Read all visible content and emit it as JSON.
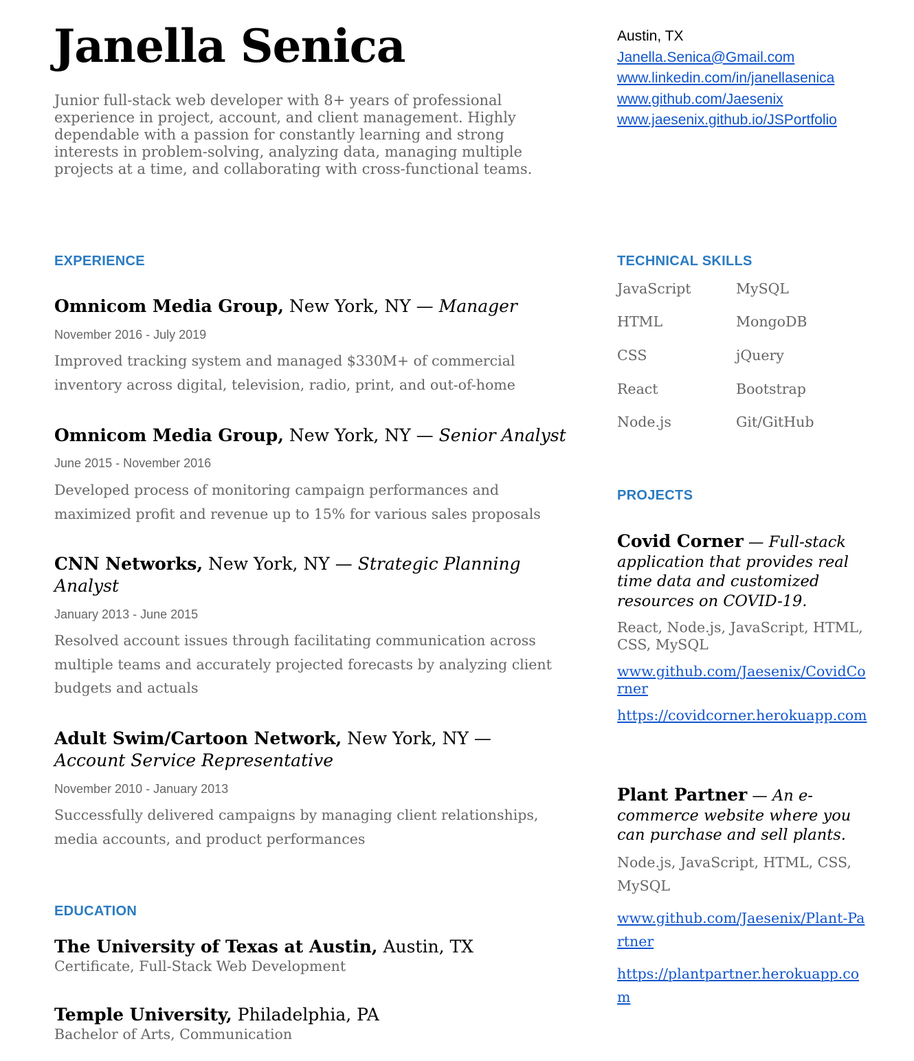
{
  "header": {
    "name": "Janella Senica",
    "summary": "Junior full-stack web developer with 8+ years of professional experience in project, account, and client management. Highly dependable with a passion for constantly learning and strong interests in problem-solving, analyzing data, managing multiple projects at a time, and collaborating with cross-functional teams."
  },
  "contact": {
    "location": "Austin, TX",
    "email": "Janella.Senica@Gmail.com",
    "linkedin": "www.linkedin.com/in/janellasenica",
    "github": "www.github.com/Jaesenix",
    "portfolio": "www.jaesenix.github.io/JSPortfolio"
  },
  "experience": {
    "heading": "EXPERIENCE",
    "jobs": [
      {
        "company": "Omnicom Media Group,",
        "location": " New York, NY — ",
        "role": "Manager",
        "dates": "November 2016  - July 2019",
        "description": "Improved tracking system and managed $330M+ of commercial inventory across digital, television, radio, print, and out-of-home"
      },
      {
        "company": "Omnicom Media Group,",
        "location": " New York, NY — ",
        "role": "Senior Analyst",
        "dates": "June 2015 - November 2016",
        "description": "Developed process of monitoring campaign performances and maximized profit and revenue up to 15% for various sales proposals"
      },
      {
        "company": "CNN Networks,",
        "location": " New York, NY — ",
        "role": "Strategic Planning Analyst",
        "dates": "January 2013 - June 2015",
        "description": "Resolved account issues through facilitating communication across multiple teams and accurately projected forecasts by analyzing client budgets and actuals"
      },
      {
        "company": "Adult Swim/Cartoon Network,",
        "location": " New York, NY — ",
        "role": "Account Service Representative",
        "dates": "November 2010 - January 2013",
        "description": "Successfully delivered campaigns by managing client relationships, media accounts, and product performances"
      }
    ]
  },
  "education": {
    "heading": "EDUCATION",
    "schools": [
      {
        "school": "The University of Texas at Austin,",
        "location": " Austin, TX",
        "degree": "Certificate, Full-Stack Web Development"
      },
      {
        "school": "Temple University,",
        "location": " Philadelphia, PA",
        "degree": "Bachelor of Arts, Communication"
      }
    ]
  },
  "skills": {
    "heading": "TECHNICAL SKILLS",
    "col1": [
      "JavaScript",
      "HTML",
      "CSS",
      "React",
      "Node.js"
    ],
    "col2": [
      "MySQL",
      "MongoDB",
      "jQuery",
      "Bootstrap",
      "Git/GitHub"
    ]
  },
  "projects": {
    "heading": "PROJECTS",
    "items": [
      {
        "name": "Covid Corner",
        "dash": " — ",
        "description": "Full-stack application that provides real time data and customized resources on COVID-19.",
        "tech": "React, Node.js, JavaScript, HTML, CSS, MySQL",
        "repo": "www.github.com/Jaesenix/CovidCorner",
        "site": "https://covidcorner.herokuapp.com"
      },
      {
        "name": "Plant Partner",
        "dash": " — ",
        "description": "An e-commerce website where you can purchase and sell plants.",
        "tech": "Node.js, JavaScript, HTML, CSS, MySQL",
        "repo": "www.github.com/Jaesenix/Plant-Partner",
        "site": "https://plantpartner.herokuapp.com"
      }
    ]
  },
  "colors": {
    "accent": "#2a7bc1",
    "link": "#1155cc",
    "muted_text": "#666666"
  }
}
